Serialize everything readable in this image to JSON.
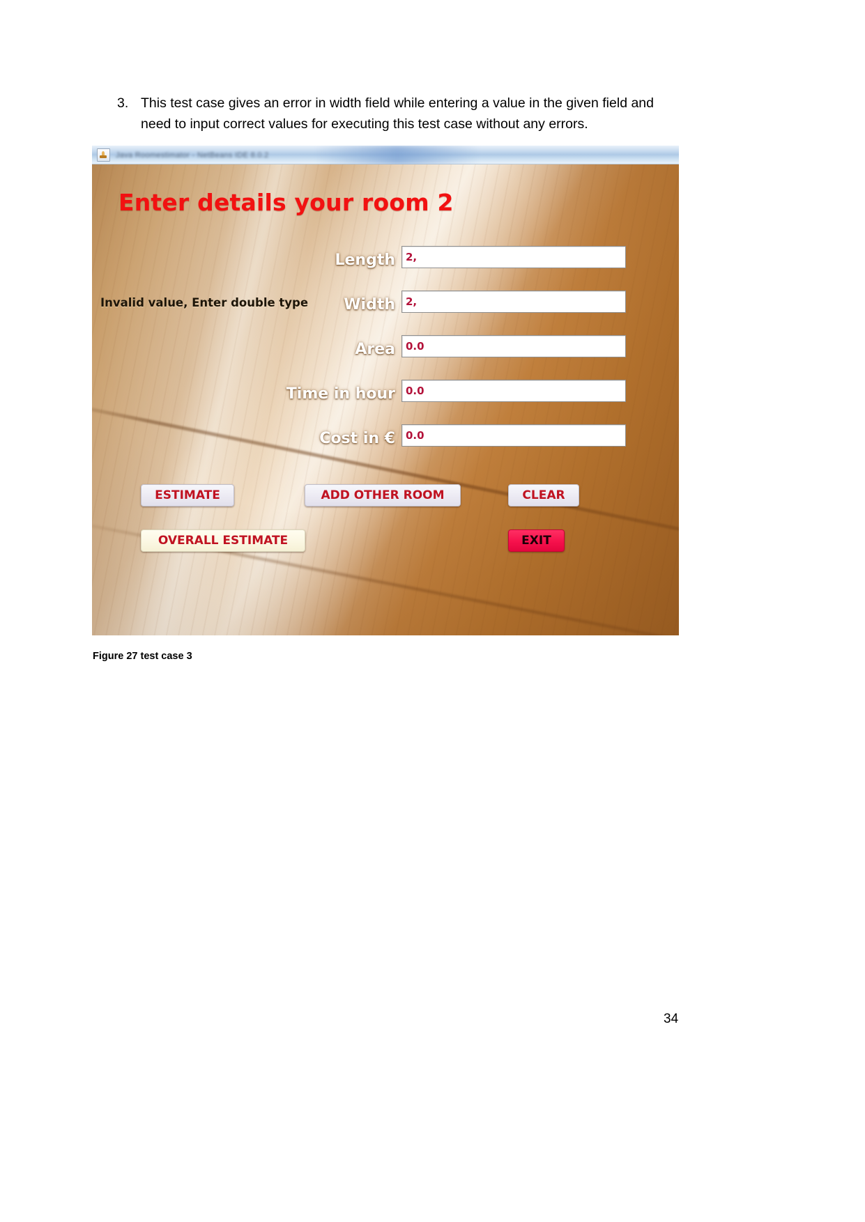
{
  "document": {
    "list_number": "3.",
    "paragraph": "This test case gives an error in width field while entering a value in the given field and need to input correct values for executing this test case without any errors.",
    "figure_caption": "Figure 27 test case 3",
    "page_number": "34"
  },
  "app": {
    "title_bar": {
      "icon": "java-coffee-cup-icon",
      "title": "Java Roomestimator - NetBeans IDE 8.0.2"
    },
    "heading": "Enter details your room 2",
    "error_message": "Invalid value, Enter double type",
    "fields": [
      {
        "label": "Length",
        "value": "2,"
      },
      {
        "label": "Width",
        "value": "2,"
      },
      {
        "label": "Area",
        "value": "0.0"
      },
      {
        "label": "Time in hour",
        "value": "0.0"
      },
      {
        "label": "Cost in €",
        "value": "0.0"
      }
    ],
    "buttons": {
      "estimate": "ESTIMATE",
      "add_other_room": "ADD OTHER ROOM",
      "clear": "CLEAR",
      "overall_estimate": "OVERALL ESTIMATE",
      "exit": "EXIT"
    },
    "colors": {
      "heading_red": "#f21111",
      "field_value_red": "#b3123a",
      "button_text_red": "#c01221",
      "exit_background": "#f6114c",
      "label_white": "#ffffff"
    }
  }
}
